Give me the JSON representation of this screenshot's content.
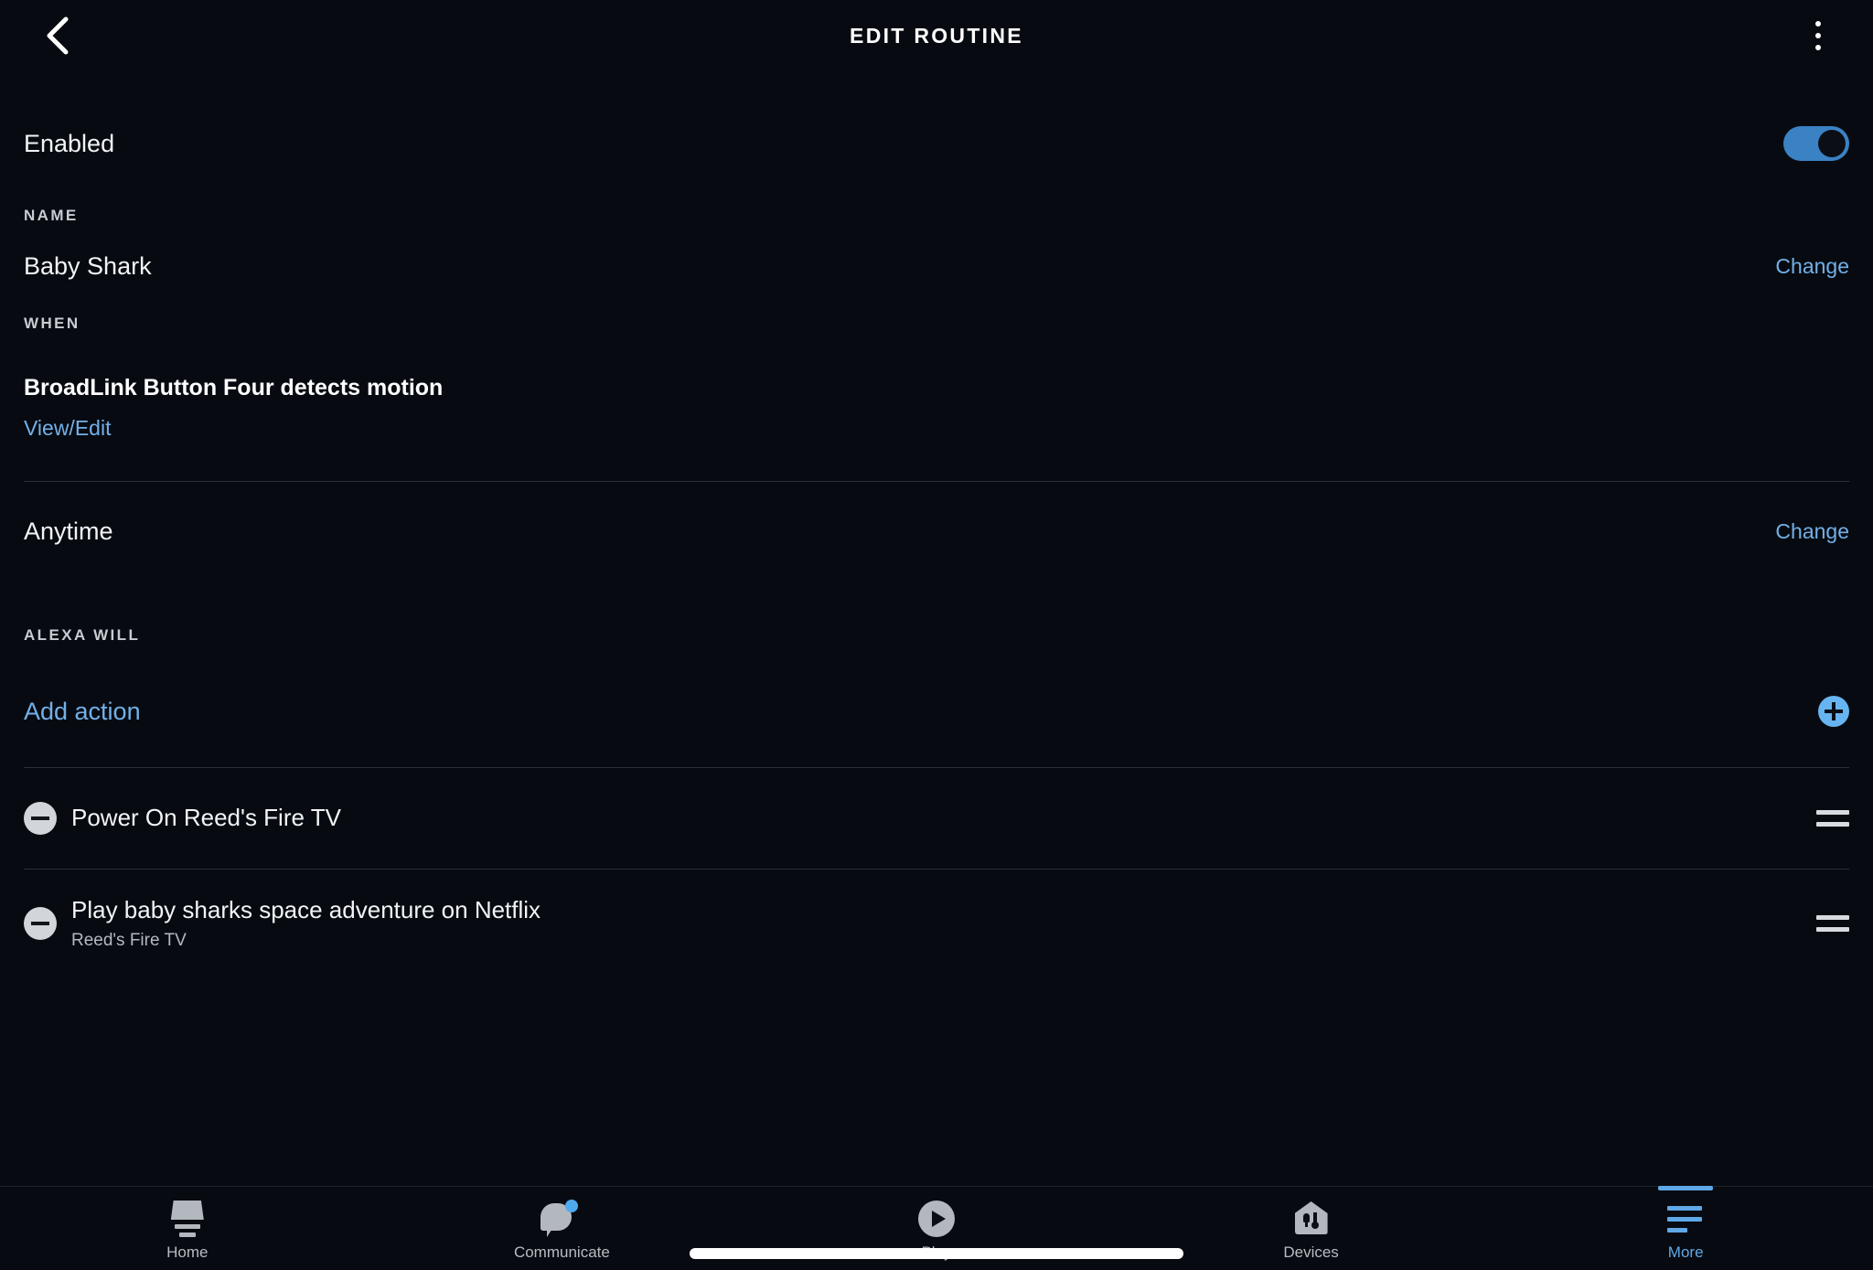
{
  "header": {
    "title": "EDIT ROUTINE",
    "back_icon": "chevron-left-icon",
    "menu_icon": "kebab-menu-icon"
  },
  "enabled": {
    "label": "Enabled",
    "toggle_on": true,
    "toggle_color": "#3b82c4"
  },
  "name_section": {
    "label": "NAME",
    "value": "Baby Shark",
    "change_label": "Change"
  },
  "when_section": {
    "label": "WHEN",
    "trigger": "BroadLink Button Four detects motion",
    "view_edit_label": "View/Edit",
    "time_value": "Anytime",
    "time_change_label": "Change"
  },
  "alexa_will_section": {
    "label": "ALEXA WILL",
    "add_action_label": "Add action",
    "add_icon": "plus-circle-icon",
    "actions": [
      {
        "title": "Power On Reed's Fire TV",
        "subtitle": "",
        "remove_icon": "minus-circle-icon",
        "drag_icon": "drag-handle-icon"
      },
      {
        "title": "Play baby sharks space adventure on Netflix",
        "subtitle": "Reed's Fire TV",
        "remove_icon": "minus-circle-icon",
        "drag_icon": "drag-handle-icon"
      }
    ]
  },
  "bottom_nav": {
    "active": "More",
    "accent_color": "#5fa8e8",
    "items": [
      {
        "label": "Home",
        "icon": "home-icon",
        "badge": false
      },
      {
        "label": "Communicate",
        "icon": "speech-bubble-icon",
        "badge": true
      },
      {
        "label": "Play",
        "icon": "play-circle-icon",
        "badge": false
      },
      {
        "label": "Devices",
        "icon": "house-devices-icon",
        "badge": false
      },
      {
        "label": "More",
        "icon": "hamburger-menu-icon",
        "badge": false
      }
    ]
  }
}
